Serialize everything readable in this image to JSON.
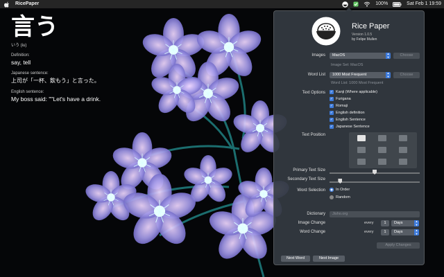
{
  "menubar": {
    "app_name": "RicePaper",
    "battery": "100%",
    "datetime": "Sat Feb 1  19:59"
  },
  "word": {
    "kanji": "言う",
    "reading": "いう (iu)",
    "definition_label": "Definition:",
    "definition": "say, tell",
    "jp_sentence_label": "Japanese sentence:",
    "jp_sentence": "上司が「一杯、飲もう」と言った。",
    "en_sentence_label": "English sentence:",
    "en_sentence": "My boss said: \"\"Let's have a drink."
  },
  "panel": {
    "title": "Rice Paper",
    "version": "Version 1.0.5",
    "author": "by Felipe Mullen",
    "images_label": "Images",
    "images_value": "MacOS",
    "images_button": "Choose",
    "images_hint": "Image Set: MacOS",
    "wordlist_label": "Word List",
    "wordlist_value": "1000 Most Frequent",
    "wordlist_button": "Choose",
    "wordlist_hint": "Word List: 1000 Most Frequent",
    "text_options_label": "Text Options",
    "text_options": [
      "Kanji (Where applicable)",
      "Furigana",
      "Romaji",
      "English definition",
      "English Sentence",
      "Japanese Sentence"
    ],
    "text_position_label": "Text Position",
    "primary_size_label": "Primary Text Size",
    "primary_size_value": 0.5,
    "secondary_size_label": "Secondary Text Size",
    "secondary_size_value": 0.1,
    "word_selection_label": "Word Selection",
    "word_selection_options": [
      "In Order",
      "Random"
    ],
    "dictionary_label": "Dictionary",
    "dictionary_value": "Jisho.org",
    "image_change_label": "Image Change",
    "image_change_every": "every",
    "image_change_count": "1",
    "image_change_unit": "Days",
    "word_change_label": "Word Change",
    "word_change_every": "every",
    "word_change_count": "1",
    "word_change_unit": "Days",
    "apply_button": "Apply Changes",
    "next_word_button": "Next Word",
    "next_image_button": "Next Image"
  },
  "colors": {
    "accent": "#3d7bdc",
    "panel_bg": "#343a42",
    "petal": "#8a86d8"
  },
  "icons": [
    "apple-icon",
    "rice-bowl-icon",
    "wifi-icon",
    "battery-icon",
    "search-icon",
    "siri-icon",
    "control-center-icon"
  ]
}
